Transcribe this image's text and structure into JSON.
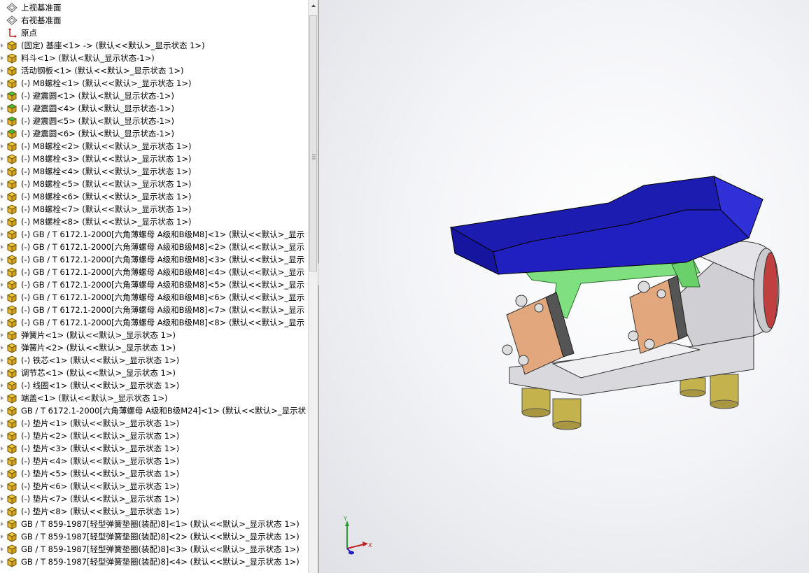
{
  "feature_tree": {
    "items": [
      {
        "label": "上视基准面",
        "icon": "plane-icon",
        "expand": false
      },
      {
        "label": "右视基准面",
        "icon": "plane-icon",
        "expand": false
      },
      {
        "label": "原点",
        "icon": "origin-icon",
        "expand": false
      },
      {
        "label": "(固定) 基座<1> -> (默认<<默认>_显示状态 1>)",
        "icon": "part-icon",
        "expand": true
      },
      {
        "label": "料斗<1> (默认<默认_显示状态-1>)",
        "icon": "part-icon",
        "expand": true
      },
      {
        "label": "活动钢板<1> (默认<<默认>_显示状态 1>)",
        "icon": "part-icon",
        "expand": true
      },
      {
        "label": "(-) M8螺栓<1> (默认<<默认>_显示状态 1>)",
        "icon": "part-icon",
        "expand": true
      },
      {
        "label": "(-) 避震圆<1> (默认<默认_显示状态-1>)",
        "icon": "part-green-icon",
        "expand": true
      },
      {
        "label": "(-) 避震圆<4> (默认<默认_显示状态-1>)",
        "icon": "part-green-icon",
        "expand": true
      },
      {
        "label": "(-) 避震圆<5> (默认<默认_显示状态-1>)",
        "icon": "part-green-icon",
        "expand": true
      },
      {
        "label": "(-) 避震圆<6> (默认<默认_显示状态-1>)",
        "icon": "part-green-icon",
        "expand": true
      },
      {
        "label": "(-) M8螺栓<2> (默认<<默认>_显示状态 1>)",
        "icon": "part-icon",
        "expand": true
      },
      {
        "label": "(-) M8螺栓<3> (默认<<默认>_显示状态 1>)",
        "icon": "part-icon",
        "expand": true
      },
      {
        "label": "(-) M8螺栓<4> (默认<<默认>_显示状态 1>)",
        "icon": "part-icon",
        "expand": true
      },
      {
        "label": "(-) M8螺栓<5> (默认<<默认>_显示状态 1>)",
        "icon": "part-icon",
        "expand": true
      },
      {
        "label": "(-) M8螺栓<6> (默认<<默认>_显示状态 1>)",
        "icon": "part-icon",
        "expand": true
      },
      {
        "label": "(-) M8螺栓<7> (默认<<默认>_显示状态 1>)",
        "icon": "part-icon",
        "expand": true
      },
      {
        "label": "(-) M8螺栓<8> (默认<<默认>_显示状态 1>)",
        "icon": "part-icon",
        "expand": true
      },
      {
        "label": "(-) GB / T 6172.1-2000[六角薄螺母 A级和B级M8]<1> (默认<<默认>_显示",
        "icon": "part-icon",
        "expand": true
      },
      {
        "label": "(-) GB / T 6172.1-2000[六角薄螺母 A级和B级M8]<2> (默认<<默认>_显示",
        "icon": "part-icon",
        "expand": true
      },
      {
        "label": "(-) GB / T 6172.1-2000[六角薄螺母 A级和B级M8]<3> (默认<<默认>_显示",
        "icon": "part-icon",
        "expand": true
      },
      {
        "label": "(-) GB / T 6172.1-2000[六角薄螺母 A级和B级M8]<4> (默认<<默认>_显示",
        "icon": "part-icon",
        "expand": true
      },
      {
        "label": "(-) GB / T 6172.1-2000[六角薄螺母 A级和B级M8]<5> (默认<<默认>_显示",
        "icon": "part-icon",
        "expand": true
      },
      {
        "label": "(-) GB / T 6172.1-2000[六角薄螺母 A级和B级M8]<6> (默认<<默认>_显示",
        "icon": "part-icon",
        "expand": true
      },
      {
        "label": "(-) GB / T 6172.1-2000[六角薄螺母 A级和B级M8]<7> (默认<<默认>_显示",
        "icon": "part-icon",
        "expand": true
      },
      {
        "label": "(-) GB / T 6172.1-2000[六角薄螺母 A级和B级M8]<8> (默认<<默认>_显示",
        "icon": "part-icon",
        "expand": true
      },
      {
        "label": "弹簧片<1> (默认<<默认>_显示状态 1>)",
        "icon": "part-icon",
        "expand": true
      },
      {
        "label": "弹簧片<2> (默认<<默认>_显示状态 1>)",
        "icon": "part-icon",
        "expand": true
      },
      {
        "label": "(-) 铁芯<1> (默认<<默认>_显示状态 1>)",
        "icon": "part-icon",
        "expand": true
      },
      {
        "label": "调节芯<1> (默认<<默认>_显示状态 1>)",
        "icon": "part-icon",
        "expand": true
      },
      {
        "label": "(-) 线圈<1> (默认<<默认>_显示状态 1>)",
        "icon": "part-icon",
        "expand": true
      },
      {
        "label": "端盖<1> (默认<<默认>_显示状态 1>)",
        "icon": "part-icon",
        "expand": true
      },
      {
        "label": "GB / T 6172.1-2000[六角薄螺母 A级和B级M24]<1> (默认<<默认>_显示状",
        "icon": "part-icon",
        "expand": true
      },
      {
        "label": "(-) 垫片<1> (默认<<默认>_显示状态 1>)",
        "icon": "part-icon",
        "expand": true
      },
      {
        "label": "(-) 垫片<2> (默认<<默认>_显示状态 1>)",
        "icon": "part-icon",
        "expand": true
      },
      {
        "label": "(-) 垫片<3> (默认<<默认>_显示状态 1>)",
        "icon": "part-icon",
        "expand": true
      },
      {
        "label": "(-) 垫片<4> (默认<<默认>_显示状态 1>)",
        "icon": "part-icon",
        "expand": true
      },
      {
        "label": "(-) 垫片<5> (默认<<默认>_显示状态 1>)",
        "icon": "part-icon",
        "expand": true
      },
      {
        "label": "(-) 垫片<6> (默认<<默认>_显示状态 1>)",
        "icon": "part-icon",
        "expand": true
      },
      {
        "label": "(-) 垫片<7> (默认<<默认>_显示状态 1>)",
        "icon": "part-icon",
        "expand": true
      },
      {
        "label": "(-) 垫片<8> (默认<<默认>_显示状态 1>)",
        "icon": "part-icon",
        "expand": true
      },
      {
        "label": "GB / T 859-1987[轻型弹簧垫圈(装配)8]<1> (默认<<默认>_显示状态 1>)",
        "icon": "part-icon",
        "expand": true
      },
      {
        "label": "GB / T 859-1987[轻型弹簧垫圈(装配)8]<2> (默认<<默认>_显示状态 1>)",
        "icon": "part-icon",
        "expand": true
      },
      {
        "label": "GB / T 859-1987[轻型弹簧垫圈(装配)8]<3> (默认<<默认>_显示状态 1>)",
        "icon": "part-icon",
        "expand": true
      },
      {
        "label": "GB / T 859-1987[轻型弹簧垫圈(装配)8]<4> (默认<<默认>_显示状态 1>)",
        "icon": "part-icon",
        "expand": true
      }
    ]
  },
  "triad": {
    "x_label": "X",
    "y_label": "Y"
  },
  "colors": {
    "hopper": "#1a1aa8",
    "plate": "#7fe07f",
    "spring": "#e0a57a",
    "base": "#d8d8dc",
    "feet": "#c8b44a"
  }
}
